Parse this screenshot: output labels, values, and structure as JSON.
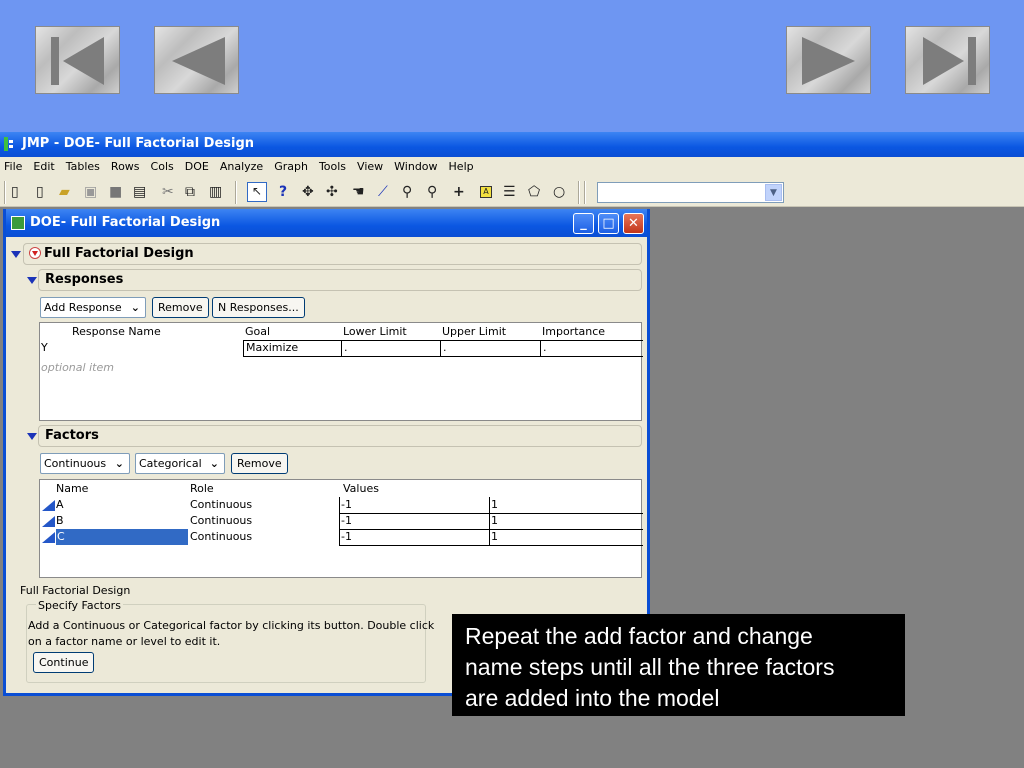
{
  "slide_nav": {
    "buttons": [
      {
        "name": "first-slide-button",
        "icon": "skip-to-start-icon"
      },
      {
        "name": "previous-slide-button",
        "icon": "back-arrow-icon"
      },
      {
        "name": "next-slide-button",
        "icon": "forward-arrow-icon"
      },
      {
        "name": "last-slide-button",
        "icon": "skip-to-end-icon"
      }
    ]
  },
  "app": {
    "title": "JMP - DOE- Full Factorial Design",
    "menu": [
      "File",
      "Edit",
      "Tables",
      "Rows",
      "Cols",
      "DOE",
      "Analyze",
      "Graph",
      "Tools",
      "View",
      "Window",
      "Help"
    ],
    "toolbar_combo_value": ""
  },
  "doe_window": {
    "title": "DOE- Full Factorial Design",
    "outline_title": "Full Factorial Design",
    "responses": {
      "header": "Responses",
      "buttons": {
        "add_response": "Add Response",
        "remove": "Remove",
        "n_responses": "N Responses..."
      },
      "columns": [
        "Response Name",
        "Goal",
        "Lower Limit",
        "Upper Limit",
        "Importance"
      ],
      "rows": [
        {
          "name": "Y",
          "goal": "Maximize",
          "lower": ".",
          "upper": ".",
          "importance": "."
        }
      ],
      "optional_item": "optional item"
    },
    "factors": {
      "header": "Factors",
      "buttons": {
        "continuous": "Continuous",
        "categorical": "Categorical",
        "remove": "Remove"
      },
      "columns": [
        "Name",
        "Role",
        "Values"
      ],
      "rows": [
        {
          "name": "A",
          "role": "Continuous",
          "low": "-1",
          "high": "1"
        },
        {
          "name": "B",
          "role": "Continuous",
          "low": "-1",
          "high": "1"
        },
        {
          "name": "C",
          "role": "Continuous",
          "low": "-1",
          "high": "1"
        }
      ]
    },
    "footer": {
      "design_label": "Full Factorial Design",
      "group_title": "Specify Factors",
      "instruction_line1": "Add a Continuous or Categorical factor by clicking its button. Double click",
      "instruction_line2": "on a factor name or level to edit it.",
      "continue": "Continue"
    }
  },
  "callout": {
    "line1": "Repeat the add factor and change",
    "line2": "name steps until all the three factors",
    "line3": "are added into the model"
  }
}
